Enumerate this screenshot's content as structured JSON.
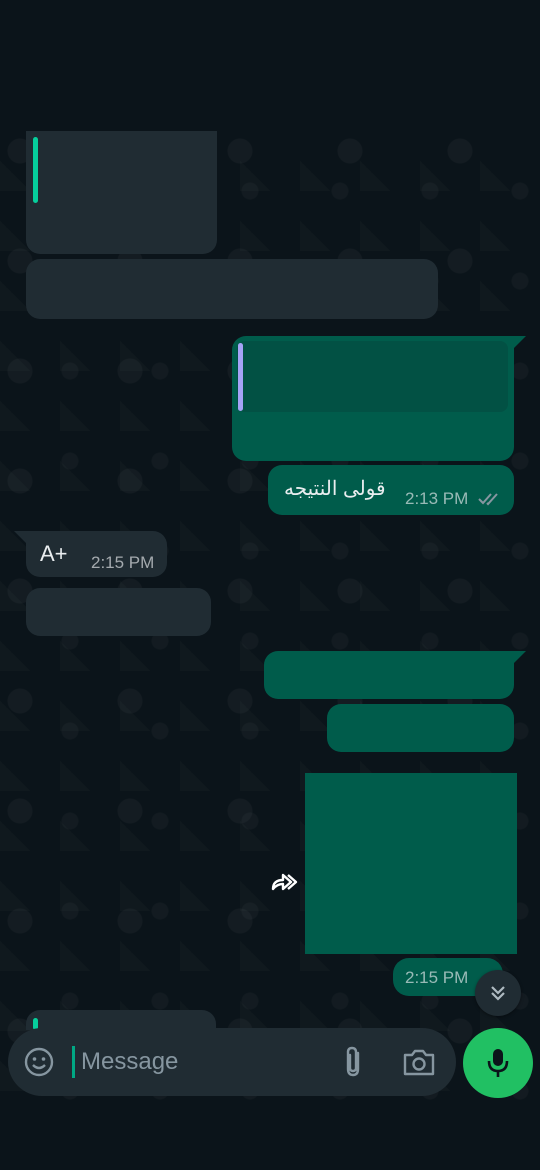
{
  "messages": [
    {
      "id": "m1",
      "direction": "in",
      "text": "",
      "time": ""
    },
    {
      "id": "m2",
      "direction": "in",
      "text": "",
      "time": ""
    },
    {
      "id": "m3",
      "direction": "out",
      "text": "",
      "time": ""
    },
    {
      "id": "m4",
      "direction": "out",
      "text": "قولى النتيجه",
      "time": "2:13 PM",
      "status": "read"
    },
    {
      "id": "m5",
      "direction": "in",
      "text": "A+",
      "time": "2:15 PM"
    },
    {
      "id": "m6",
      "direction": "in",
      "text": "",
      "time": ""
    },
    {
      "id": "m7",
      "direction": "out",
      "text": "",
      "time": ""
    },
    {
      "id": "m8",
      "direction": "out",
      "text": "",
      "time": ""
    },
    {
      "id": "m9",
      "direction": "out",
      "type": "image",
      "time": "2:15 PM"
    }
  ],
  "composer": {
    "placeholder": "Message"
  },
  "colors": {
    "background": "#0b141a",
    "incoming": "#202c33",
    "outgoing": "#005c4b",
    "accent": "#00a884",
    "mic": "#21c063",
    "quote_green": "#06cf9c",
    "quote_purple": "#a5a3f6"
  },
  "icons": {
    "emoji": "emoji-icon",
    "attach": "paperclip-icon",
    "camera": "camera-icon",
    "mic": "mic-icon",
    "forward": "forward-icon",
    "scroll": "chevron-double-down-icon",
    "ticks": "double-check-icon"
  }
}
